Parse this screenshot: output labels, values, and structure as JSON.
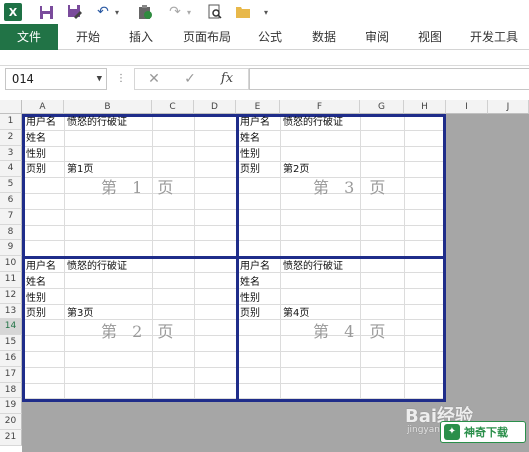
{
  "qat": {
    "app_icon": "X",
    "icons": [
      "save-icon",
      "save-as-icon",
      "undo-icon",
      "undo-dropdown",
      "clipboard-icon",
      "redo-icon",
      "redo-dropdown",
      "print-preview-icon",
      "folder-icon",
      "customize-qat-dropdown"
    ]
  },
  "ribbon": {
    "tabs": [
      "文件",
      "开始",
      "插入",
      "页面布局",
      "公式",
      "数据",
      "审阅",
      "视图",
      "开发工具"
    ]
  },
  "formula_bar": {
    "name_box": "O14",
    "cancel_symbol": "✕",
    "enter_symbol": "✓",
    "fx_label": "fx",
    "formula": ""
  },
  "grid": {
    "columns": [
      "A",
      "B",
      "C",
      "D",
      "E",
      "F",
      "G",
      "H",
      "I",
      "J"
    ],
    "rows": [
      "1",
      "2",
      "3",
      "4",
      "5",
      "6",
      "7",
      "8",
      "9",
      "10",
      "11",
      "12",
      "13",
      "14",
      "15",
      "16",
      "17",
      "18",
      "19",
      "20",
      "21"
    ],
    "selected_row": "14",
    "blocks": [
      {
        "r1": "用户名",
        "r1b": "愤怒的行破证",
        "r2": "姓名",
        "r3": "性别",
        "r4": "页别",
        "r4b": "第1页",
        "watermark": "第 1 页"
      },
      {
        "r1": "用户名",
        "r1b": "愤怒的行破证",
        "r2": "姓名",
        "r3": "性别",
        "r4": "页别",
        "r4b": "第2页",
        "watermark": "第 3 页"
      },
      {
        "r1": "用户名",
        "r1b": "愤怒的行破证",
        "r2": "姓名",
        "r3": "性别",
        "r4": "页别",
        "r4b": "第3页",
        "watermark": "第 2 页"
      },
      {
        "r1": "用户名",
        "r1b": "愤怒的行破证",
        "r2": "姓名",
        "r3": "性别",
        "r4": "页别",
        "r4b": "第4页",
        "watermark": "第 4 页"
      }
    ]
  },
  "watermarks": {
    "baidu": "Bai经验",
    "baidu_sub": "jingyan.baidu.com",
    "site_logo": "神奇下载"
  },
  "colors": {
    "excel_green": "#217346",
    "page_break": "#1f2d8a",
    "outside_print_area": "#a6a6a6"
  }
}
